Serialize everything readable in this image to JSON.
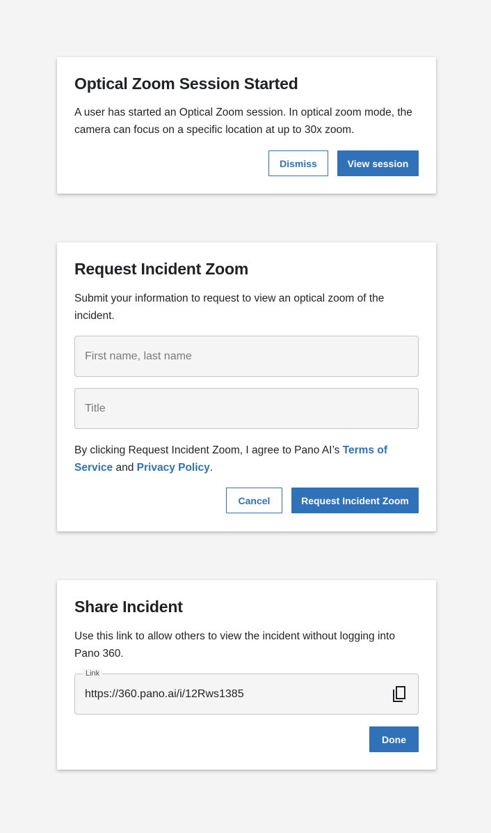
{
  "session_card": {
    "title": "Optical Zoom Session Started",
    "body": "A user has started an Optical Zoom session. In optical zoom mode, the camera can focus on a specific location at up to 30x zoom.",
    "dismiss_label": "Dismiss",
    "view_label": "View session"
  },
  "request_card": {
    "title": "Request Incident Zoom",
    "body": "Submit your information to request to view an optical zoom of the incident.",
    "name_placeholder": "First name, last name",
    "title_placeholder": "Title",
    "consent_prefix": "By clicking Request Incident Zoom, I agree to Pano AI’s ",
    "terms_label": "Terms of Service",
    "consent_and": " and ",
    "privacy_label": "Privacy Policy",
    "consent_suffix": ".",
    "cancel_label": "Cancel",
    "submit_label": "Request Incident Zoom"
  },
  "share_card": {
    "title": "Share Incident",
    "body": "Use this link to allow others to view the incident without logging into Pano 360.",
    "link_label": "Link",
    "link_value": "https://360.pano.ai/i/12Rws1385",
    "copy_icon": "copy-icon",
    "done_label": "Done"
  },
  "colors": {
    "accent": "#2f72b9",
    "background": "#f4f4f4",
    "card": "#ffffff"
  }
}
